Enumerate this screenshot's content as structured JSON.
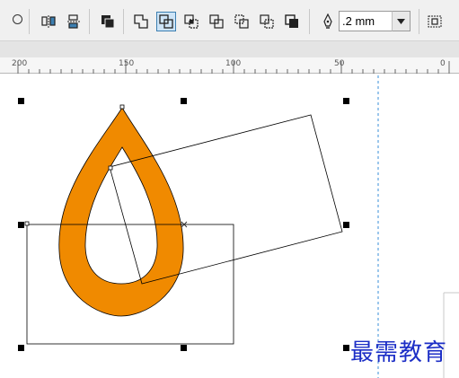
{
  "toolbar": {
    "outline_width": ".2 mm",
    "tools": [
      {
        "icon": "circle-icon"
      },
      {
        "icon": "mirror-horizontal-icon"
      },
      {
        "icon": "mirror-vertical-icon"
      },
      {
        "icon": "combine-icon"
      },
      {
        "icon": "weld-icon"
      },
      {
        "icon": "trim-icon"
      },
      {
        "icon": "intersect-icon"
      },
      {
        "icon": "simplify-icon"
      },
      {
        "icon": "front-minus-back-icon"
      },
      {
        "icon": "back-minus-front-icon"
      },
      {
        "icon": "create-boundary-icon"
      },
      {
        "icon": "pen-nib-icon"
      },
      {
        "icon": "align-icon"
      }
    ]
  },
  "ruler": {
    "labels": [
      "200",
      "150",
      "100",
      "50",
      "0"
    ]
  },
  "canvas": {
    "shape_fill": "#f08a00",
    "outline_color": "#000000",
    "guide_color": "#3a8fd8"
  },
  "watermark": "最需教育"
}
